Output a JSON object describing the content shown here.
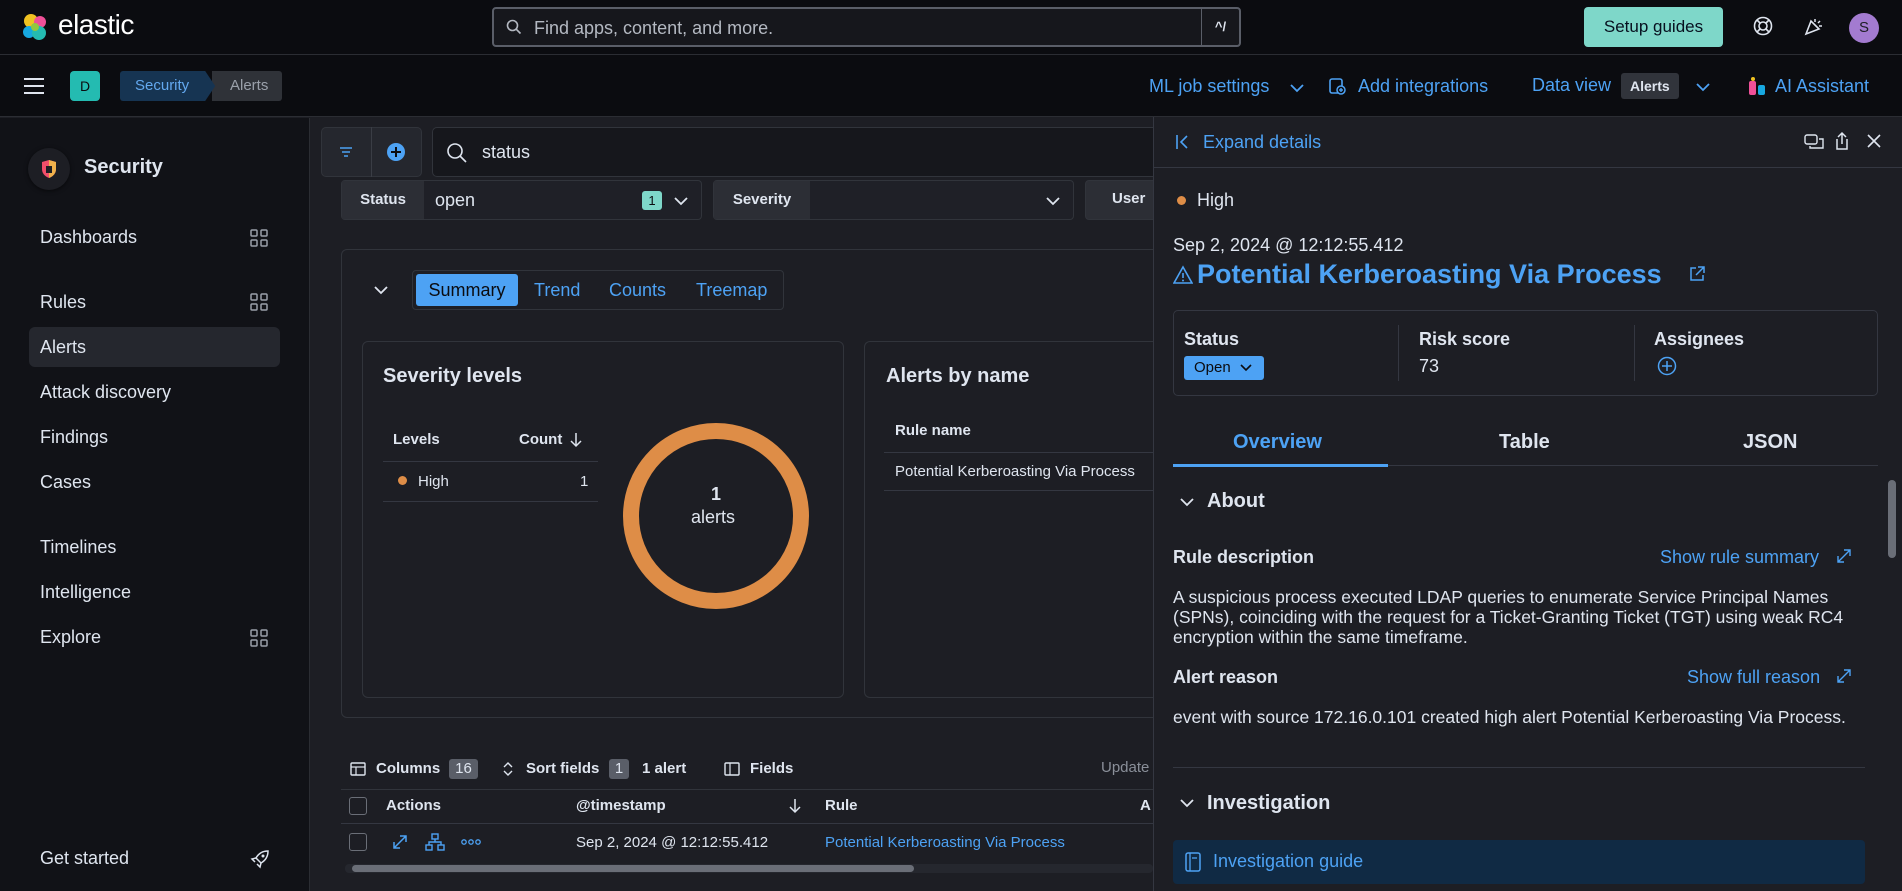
{
  "app": {
    "name": "elastic"
  },
  "search": {
    "placeholder": "Find apps, content, and more.",
    "shortcut": "^/"
  },
  "header": {
    "setup_guides": "Setup guides",
    "avatar_initial": "S"
  },
  "subheader": {
    "space_initial": "D",
    "breadcrumbs": [
      "Security",
      "Alerts"
    ],
    "ml_job_settings": "ML job settings",
    "add_integrations": "Add integrations",
    "data_view_label": "Data view",
    "data_view_value": "Alerts",
    "ai_assistant": "AI Assistant"
  },
  "sidebar": {
    "title": "Security",
    "items": [
      "Dashboards",
      "Rules",
      "Alerts",
      "Attack discovery",
      "Findings",
      "Cases",
      "Timelines",
      "Intelligence",
      "Explore"
    ],
    "footer": "Get started"
  },
  "query": {
    "text": "status"
  },
  "filters": {
    "status_label": "Status",
    "status_value": "open",
    "status_count": "1",
    "severity_label": "Severity",
    "user_label": "User"
  },
  "summary_tabs": [
    "Summary",
    "Trend",
    "Counts",
    "Treemap"
  ],
  "severity_panel": {
    "title": "Severity levels",
    "col_levels": "Levels",
    "col_count": "Count",
    "row_level": "High",
    "row_count": "1",
    "donut_value": "1",
    "donut_label": "alerts",
    "donut_color": "#de8d47"
  },
  "alerts_by_name": {
    "title": "Alerts by name",
    "col_rule": "Rule name",
    "row_rule": "Potential Kerberoasting Via Process"
  },
  "table_toolbar": {
    "columns": "Columns",
    "columns_count": "16",
    "sort_fields": "Sort fields",
    "sort_count": "1",
    "alert_count": "1 alert",
    "fields": "Fields",
    "updated": "Update"
  },
  "table": {
    "headers": [
      "Actions",
      "@timestamp",
      "Rule",
      "A"
    ],
    "row": {
      "timestamp": "Sep 2, 2024 @ 12:12:55.412",
      "rule": "Potential Kerberoasting Via Process"
    }
  },
  "flyout": {
    "expand_details": "Expand details",
    "severity": "High",
    "timestamp": "Sep 2, 2024 @ 12:12:55.412",
    "title": "Potential Kerberoasting Via Process",
    "status_label": "Status",
    "status_value": "Open",
    "risk_label": "Risk score",
    "risk_value": "73",
    "assignees_label": "Assignees",
    "tabs": [
      "Overview",
      "Table",
      "JSON"
    ],
    "about": "About",
    "rule_description_label": "Rule description",
    "show_rule_summary": "Show rule summary",
    "rule_description": "A suspicious process executed LDAP queries to enumerate Service Principal Names (SPNs), coinciding with the request for a Ticket-Granting Ticket (TGT) using weak RC4 encryption within the same timeframe.",
    "alert_reason_label": "Alert reason",
    "show_full_reason": "Show full reason",
    "alert_reason": "event with source 172.16.0.101 created high alert Potential Kerberoasting Via Process.",
    "investigation": "Investigation",
    "investigation_guide": "Investigation guide"
  },
  "colors": {
    "accent": "#4da2f4",
    "high": "#de8d47",
    "teal": "#7ed7c9"
  }
}
